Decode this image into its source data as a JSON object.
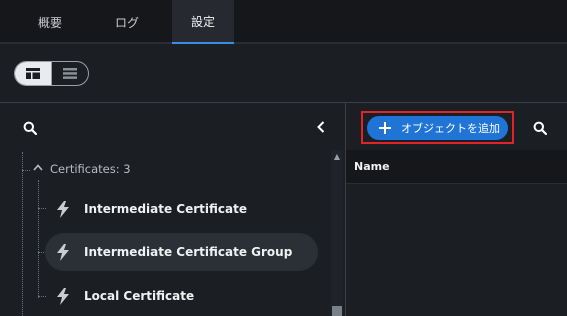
{
  "tabs": [
    {
      "label": "概要"
    },
    {
      "label": "ログ"
    },
    {
      "label": "設定",
      "active": true
    }
  ],
  "view_toggle": {
    "selected": "tree-view",
    "options": [
      "tree-view",
      "list-view"
    ]
  },
  "left_pane": {
    "search_icon": "search-icon",
    "collapse_icon": "chevron-left-icon",
    "group": {
      "label": "Certificates: 3",
      "expanded": true
    },
    "items": [
      {
        "label": "Intermediate Certificate",
        "icon": "bolt-icon",
        "selected": false
      },
      {
        "label": "Intermediate Certificate Group",
        "icon": "bolt-icon",
        "selected": true
      },
      {
        "label": "Local Certificate",
        "icon": "bolt-icon",
        "selected": false
      }
    ]
  },
  "right_pane": {
    "add_button_label": "オブジェクトを追加",
    "search_icon": "search-icon",
    "columns": [
      {
        "label": "Name"
      }
    ]
  },
  "colors": {
    "accent": "#1f74d6",
    "highlight_box": "#e0242a",
    "background": "#1b1e23",
    "header_background": "#15171b"
  }
}
